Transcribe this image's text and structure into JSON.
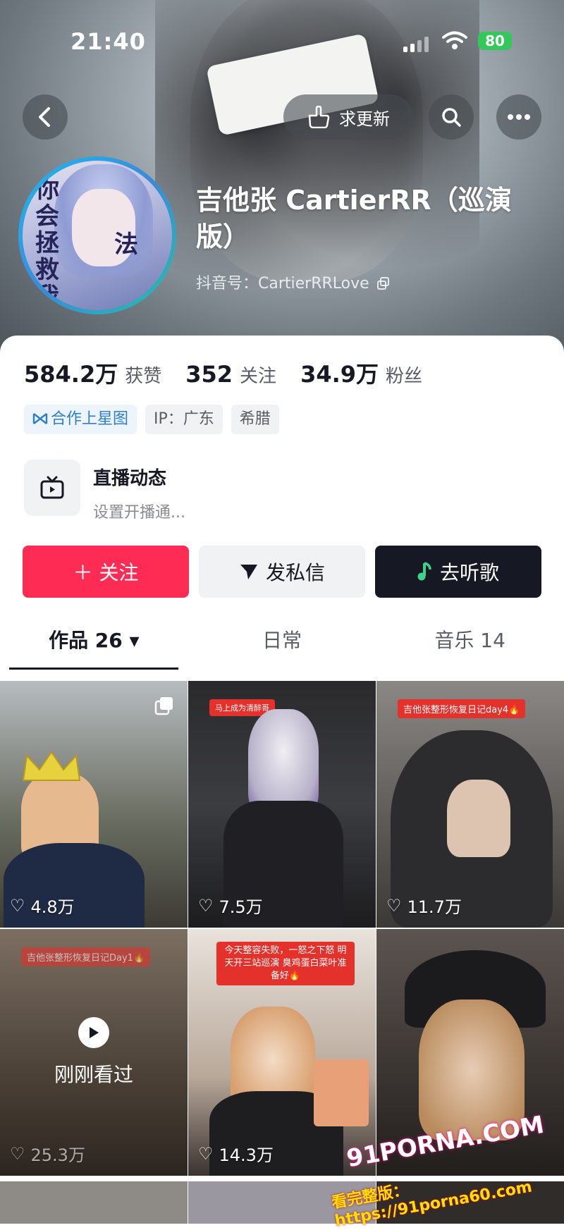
{
  "status_bar": {
    "time": "21:40",
    "battery": "80"
  },
  "header": {
    "back_icon": "chevron-left-icon",
    "request_update_label": "求更新",
    "search_icon": "search-icon",
    "more_icon": "ellipsis-icon"
  },
  "profile": {
    "name": "吉他张 CartierRR（巡演版）",
    "douyin_id": "抖音号：CartierRRLove",
    "avatar_text": [
      "你会拯救我吗",
      "法"
    ]
  },
  "stats": [
    {
      "value": "584.2万",
      "label": "获赞"
    },
    {
      "value": "352",
      "label": "关注"
    },
    {
      "value": "34.9万",
      "label": "粉丝"
    }
  ],
  "tags": [
    {
      "label": "合作上星图"
    },
    {
      "label": "IP：广东"
    },
    {
      "label": "希腊"
    }
  ],
  "live": {
    "title": "直播动态",
    "subtitle": "设置开播通..."
  },
  "actions": {
    "follow": "＋ 关注",
    "message": "发私信",
    "music": "去听歌"
  },
  "tabs": [
    {
      "label": "作品 26 ▾"
    },
    {
      "label": "日常"
    },
    {
      "label": "音乐 14"
    }
  ],
  "videos": [
    {
      "likes": "4.8万",
      "badge": ""
    },
    {
      "likes": "7.5万",
      "badge": "马上成为清醉哥"
    },
    {
      "likes": "11.7万",
      "badge": "吉他张整形恢复日记day4🔥"
    },
    {
      "likes": "25.3万",
      "badge": "吉他张整形恢复日记Day1🔥",
      "watched": "刚刚看过"
    },
    {
      "likes": "14.3万",
      "badge": "今天整容失败，一怒之下怒 明天开三站巡演 臭鸡蛋白菜叶准备好🔥"
    },
    {
      "likes": "",
      "badge": ""
    }
  ],
  "watermark": {
    "line1": "91PORNA.COM",
    "line2": "看完整版：https://91porna60.com"
  },
  "colors": {
    "follow": "#fe2c55",
    "music": "#161823",
    "tag_blue": "#2f7fc7",
    "battery": "#34c759"
  }
}
